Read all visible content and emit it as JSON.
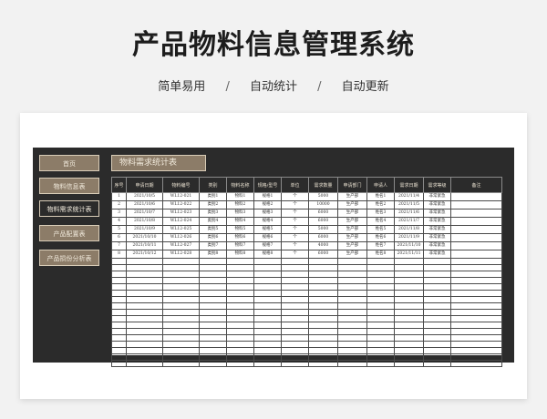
{
  "header": {
    "title": "产品物料信息管理系统",
    "tags": [
      "简单易用",
      "自动统计",
      "自动更新"
    ],
    "separator": "/"
  },
  "nav": {
    "items": [
      {
        "label": "首页",
        "state": "gold"
      },
      {
        "label": "物料信息表",
        "state": "gold"
      },
      {
        "label": "物料需求统计表",
        "state": "active"
      },
      {
        "label": "产品配置表",
        "state": "gold"
      },
      {
        "label": "产品损份分析表",
        "state": "gold"
      }
    ]
  },
  "sheet": {
    "title": "物料需求统计表",
    "columns": [
      "序号",
      "申请日期",
      "物料编号",
      "类别",
      "物料名称",
      "规格/型号",
      "单位",
      "需求数量",
      "申请部门",
      "申请人",
      "需求日期",
      "需求等级",
      "备注"
    ],
    "rows": [
      [
        "1",
        "2021/10/5",
        "WL12-021",
        "类别1",
        "物料1",
        "规格1",
        "个",
        "5000",
        "生产部",
        "姓名1",
        "2021/11/4",
        "非常紧急",
        ""
      ],
      [
        "2",
        "2021/10/6",
        "WL12-022",
        "类别2",
        "物料2",
        "规格2",
        "个",
        "10000",
        "生产部",
        "姓名2",
        "2021/11/5",
        "非常紧急",
        ""
      ],
      [
        "3",
        "2021/10/7",
        "WL12-023",
        "类别3",
        "物料3",
        "规格3",
        "个",
        "6000",
        "生产部",
        "姓名3",
        "2021/11/6",
        "非常紧急",
        ""
      ],
      [
        "4",
        "2021/10/8",
        "WL12-024",
        "类别4",
        "物料4",
        "规格4",
        "个",
        "6000",
        "生产部",
        "姓名4",
        "2021/11/7",
        "非常紧急",
        ""
      ],
      [
        "5",
        "2021/10/9",
        "WL12-025",
        "类别5",
        "物料5",
        "规格5",
        "个",
        "5000",
        "生产部",
        "姓名5",
        "2021/11/8",
        "非常紧急",
        ""
      ],
      [
        "6",
        "2021/10/10",
        "WL12-026",
        "类别6",
        "物料6",
        "规格6",
        "个",
        "6000",
        "生产部",
        "姓名6",
        "2021/11/9",
        "非常紧急",
        ""
      ],
      [
        "7",
        "2021/10/11",
        "WL12-027",
        "类别7",
        "物料7",
        "规格7",
        "个",
        "4000",
        "生产部",
        "姓名7",
        "2021/11/10",
        "非常紧急",
        ""
      ],
      [
        "8",
        "2021/10/12",
        "WL12-028",
        "类别8",
        "物料8",
        "规格8",
        "个",
        "6000",
        "生产部",
        "姓名8",
        "2021/11/11",
        "非常紧急",
        ""
      ]
    ],
    "empty_rows": 17
  }
}
